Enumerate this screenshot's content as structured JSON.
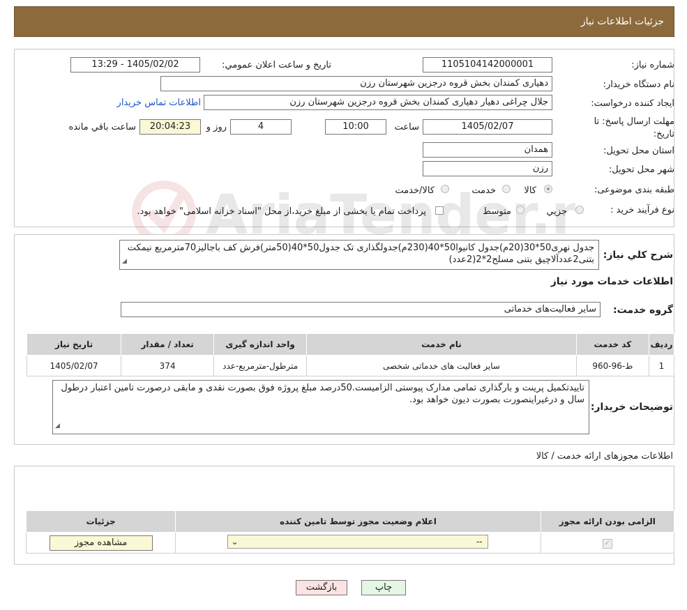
{
  "header": {
    "title": "جزئیات اطلاعات نیاز"
  },
  "info": {
    "need_number_label": "شماره نیاز:",
    "need_number": "1105104142000001",
    "announce_label": "تاریخ و ساعت اعلان عمومي:",
    "announce_value": "1405/02/02 - 13:29",
    "buyer_org_label": "نام دستگاه خریدار:",
    "buyer_org": "دهیاری کمندان بخش قروه درجزین شهرستان رزن",
    "requester_label": "ایجاد کننده درخواست:",
    "requester": "جلال چراغی دهیار دهیاری کمندان بخش قروه درجزین شهرستان رزن",
    "contact_link": "اطلاعات تماس خریدار",
    "deadline_label": "مهلت ارسال پاسخ: تا تاریخ:",
    "deadline_date": "1405/02/07",
    "time_label": "ساعت",
    "deadline_time": "10:00",
    "days": "4",
    "days_label": "روز و",
    "remaining": "20:04:23",
    "remaining_label": "ساعت باقي مانده",
    "province_label": "استان محل تحویل:",
    "province": "همدان",
    "city_label": "شهر محل تحویل:",
    "city": "رزن",
    "category_label": "طبقه بندی موضوعی:",
    "category_options": [
      "کالا",
      "خدمت",
      "کالا/خدمت"
    ],
    "category_selected": "خدمت",
    "process_label": "نوع فرآیند خرید :",
    "process_options": [
      "جزیي",
      "متوسط"
    ],
    "payment_note": "پرداخت تمام یا بخشی از مبلغ خرید،از محل \"اسناد خزانه اسلامی\" خواهد بود."
  },
  "summary": {
    "label": "شرح کلي نیاز:",
    "text": "جدول نهری50*30(20م)جدول کانیوا50*40(230م)جدولگذاری تک جدول50*40(50متر)فرش کف باجالیز70مترمربع  نیمکت بتنی2عددآلاچیق بتنی مسلح2*2(2عدد)"
  },
  "services": {
    "section_title": "اطلاعات خدمات مورد نیاز",
    "group_label": "گروه خدمت:",
    "group_value": "سایر فعالیت‌های خدماتی",
    "columns": [
      "ردیف",
      "کد خدمت",
      "نام خدمت",
      "واحد اندازه گیری",
      "تعداد / مقدار",
      "تاریخ نیاز"
    ],
    "rows": [
      [
        "1",
        "ط-96-960",
        "سایر فعالیت های خدماتی شخصی",
        "مترطول-مترمربع-عدد",
        "374",
        "1405/02/07"
      ]
    ]
  },
  "buyer_notes": {
    "label": "توضیحات خریدار:",
    "text": "تاییدتکمیل پرینت و بارگذاری تمامی مدارک پیوستی الزامیست.50درصد مبلغ پروژه فوق بصورت نقدی و مابقی درصورت تامین اعتبار درطول سال و درغیراینصورت بصورت دیون خواهد بود."
  },
  "licenses": {
    "section_title": "اطلاعات مجوزهای ارائه خدمت / کالا",
    "columns": [
      "الزامی بودن ارائه مجوز",
      "اعلام وضعیت مجوز توسط تامین کننده",
      "جزئیات"
    ],
    "select_value": "--",
    "view_button": "مشاهده مجوز"
  },
  "footer": {
    "print_button": "چاپ",
    "back_button": "بازگشت"
  },
  "watermark_text": "AriaTender.neT",
  "colors": {
    "header_bg": "#8c6a3c",
    "field_yellow": "#fbf8d6",
    "link": "#1a55c8",
    "back_button_bg": "#fbe3e3",
    "print_button_bg": "#e4f7e4"
  }
}
